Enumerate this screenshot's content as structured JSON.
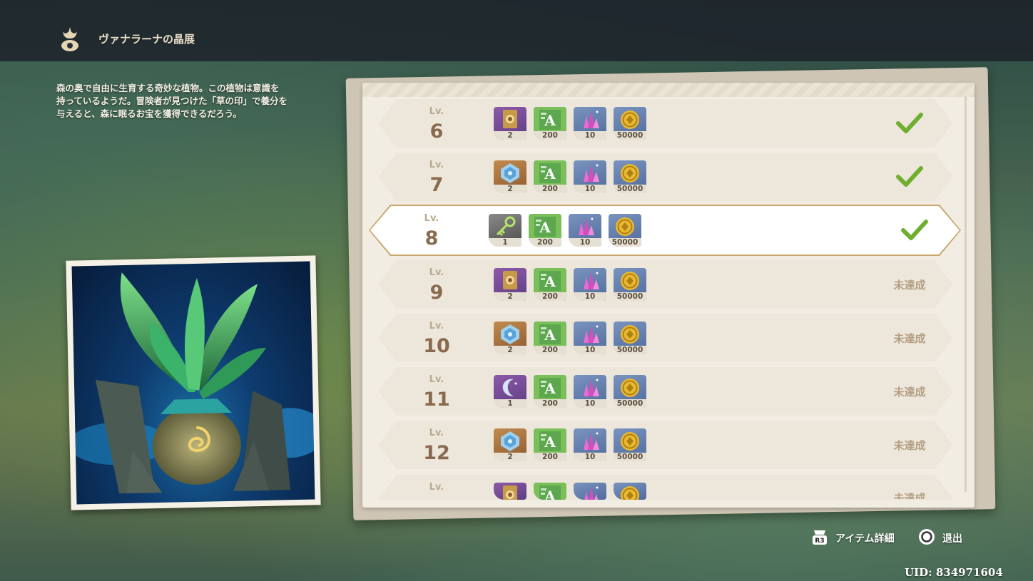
{
  "header": {
    "title": "ヴァナラーナの晶展",
    "icon": "tree-emblem-icon"
  },
  "description": "森の奥で自由に生育する奇妙な植物。この植物は意識を\n持っているようだ。冒険者が見つけた「草の印」で養分を\n与えると、森に眠るお宝を獲得できるだろう。",
  "lv_label": "Lv.",
  "rows": [
    {
      "level": "6",
      "status": "done",
      "status_text": "",
      "highlight": false,
      "items": [
        {
          "icon": "namecard-icon",
          "bg": "purple",
          "count": "2"
        },
        {
          "icon": "hero-wit-icon",
          "bg": "green",
          "count": "200"
        },
        {
          "icon": "crystal-icon",
          "bg": "blue",
          "count": "10"
        },
        {
          "icon": "mora-icon",
          "bg": "blue",
          "count": "50000"
        }
      ]
    },
    {
      "level": "7",
      "status": "done",
      "status_text": "",
      "highlight": false,
      "items": [
        {
          "icon": "gem-icon",
          "bg": "orange",
          "count": "2"
        },
        {
          "icon": "hero-wit-icon",
          "bg": "green",
          "count": "200"
        },
        {
          "icon": "crystal-icon",
          "bg": "blue",
          "count": "10"
        },
        {
          "icon": "mora-icon",
          "bg": "blue",
          "count": "50000"
        }
      ]
    },
    {
      "level": "8",
      "status": "done",
      "status_text": "",
      "highlight": true,
      "items": [
        {
          "icon": "key-icon",
          "bg": "gray",
          "count": "1"
        },
        {
          "icon": "hero-wit-icon",
          "bg": "green",
          "count": "200"
        },
        {
          "icon": "crystal-icon",
          "bg": "blue",
          "count": "10"
        },
        {
          "icon": "mora-icon",
          "bg": "blue",
          "count": "50000"
        }
      ]
    },
    {
      "level": "9",
      "status": "pending",
      "status_text": "未達成",
      "highlight": false,
      "items": [
        {
          "icon": "namecard-icon",
          "bg": "purple",
          "count": "2"
        },
        {
          "icon": "hero-wit-icon",
          "bg": "green",
          "count": "200"
        },
        {
          "icon": "crystal-icon",
          "bg": "blue",
          "count": "10"
        },
        {
          "icon": "mora-icon",
          "bg": "blue",
          "count": "50000"
        }
      ]
    },
    {
      "level": "10",
      "status": "pending",
      "status_text": "未達成",
      "highlight": false,
      "items": [
        {
          "icon": "gem-icon",
          "bg": "orange",
          "count": "2"
        },
        {
          "icon": "hero-wit-icon",
          "bg": "green",
          "count": "200"
        },
        {
          "icon": "crystal-icon",
          "bg": "blue",
          "count": "10"
        },
        {
          "icon": "mora-icon",
          "bg": "blue",
          "count": "50000"
        }
      ]
    },
    {
      "level": "11",
      "status": "pending",
      "status_text": "未達成",
      "highlight": false,
      "items": [
        {
          "icon": "moon-icon",
          "bg": "purple",
          "count": "1"
        },
        {
          "icon": "hero-wit-icon",
          "bg": "green",
          "count": "200"
        },
        {
          "icon": "crystal-icon",
          "bg": "blue",
          "count": "10"
        },
        {
          "icon": "mora-icon",
          "bg": "blue",
          "count": "50000"
        }
      ]
    },
    {
      "level": "12",
      "status": "pending",
      "status_text": "未達成",
      "highlight": false,
      "items": [
        {
          "icon": "gem-icon",
          "bg": "orange",
          "count": "2"
        },
        {
          "icon": "hero-wit-icon",
          "bg": "green",
          "count": "200"
        },
        {
          "icon": "crystal-icon",
          "bg": "blue",
          "count": "10"
        },
        {
          "icon": "mora-icon",
          "bg": "blue",
          "count": "50000"
        }
      ]
    },
    {
      "level": "",
      "status": "pending",
      "status_text": "未達成",
      "highlight": false,
      "partial": true,
      "items": [
        {
          "icon": "namecard-icon",
          "bg": "purple",
          "count": ""
        },
        {
          "icon": "hero-wit-icon",
          "bg": "green",
          "count": ""
        },
        {
          "icon": "crystal-icon",
          "bg": "blue",
          "count": ""
        },
        {
          "icon": "mora-icon",
          "bg": "blue",
          "count": ""
        }
      ]
    }
  ],
  "footer": {
    "item_detail_key": "R3",
    "item_detail_label": "アイテム詳細",
    "exit_label": "退出",
    "uid": "UID: 834971604"
  },
  "colors": {
    "check": "#6fae2f",
    "highlight_border": "#c9a56b",
    "level_text": "#8a6a4e"
  }
}
